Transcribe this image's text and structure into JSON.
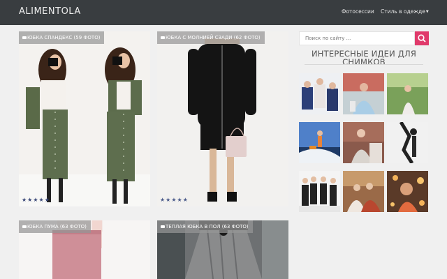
{
  "header": {
    "brand": "ALIMENTOLA",
    "nav": [
      {
        "label": "Фотосессии"
      },
      {
        "label": "Стиль в одежде"
      }
    ]
  },
  "posts": [
    {
      "title": "ЮБКА СПАНДЕКС (59 ФОТО)",
      "rating": 5
    },
    {
      "title": "ЮБКА С МОЛНИЕЙ СЗАДИ (62 ФОТО)",
      "rating": 5
    },
    {
      "title": "ЮБКА ПУМА (63 ФОТО)"
    },
    {
      "title": "ТЕПЛАЯ ЮБКА В ПОЛ (63 ФОТО)"
    }
  ],
  "sidebar": {
    "search_placeholder": "Поиск по сайту ...",
    "title": "ИНТЕРЕСНЫЕ ИДЕИ ДЛЯ СНИМКОВ"
  },
  "colors": {
    "topbar": "#393d40",
    "accent": "#e03a6b",
    "page_bg": "#f0f0f0",
    "star": "#4a5a8a"
  }
}
